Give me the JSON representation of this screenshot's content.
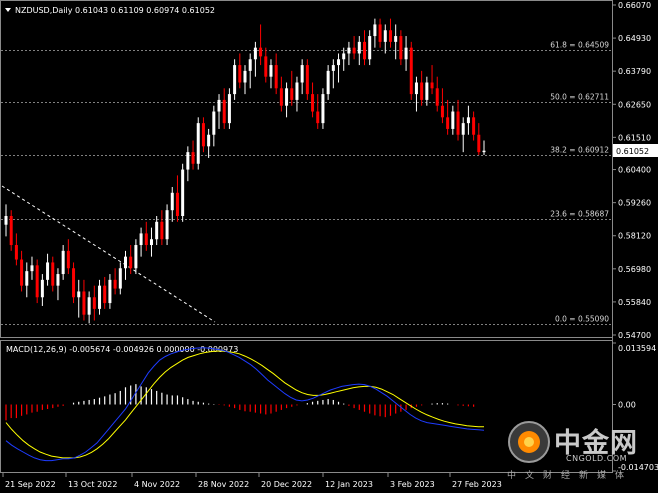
{
  "symbol_line": "NZDUSD,Daily  0.61043 0.61109 0.60974 0.61052",
  "macd_label": "MACD(12,26,9) -0.005674 -0.004926 0.000000 -0.000973",
  "colors": {
    "up": "#ffffff",
    "down": "#ff0000",
    "macd_line": "#1e3cff",
    "signal_line": "#ffff00",
    "hist_down": "#ff0000",
    "hist_up": "#ffffff",
    "trend_line": "#ffffff",
    "fib_line": "#808080"
  },
  "price_axis": [
    "0.66070",
    "0.64930",
    "0.63790",
    "0.62650",
    "0.61510",
    "0.60400",
    "0.59260",
    "0.58120",
    "0.56980",
    "0.55840",
    "0.54700"
  ],
  "current_price": "0.61052",
  "macd_axis": [
    "0.013594",
    "0.00",
    "-0.014703"
  ],
  "time_axis": [
    "21 Sep 2022",
    "13 Oct 2022",
    "4 Nov 2022",
    "28 Nov 2022",
    "20 Dec 2022",
    "12 Jan 2023",
    "3 Feb 2023",
    "27 Feb 2023"
  ],
  "fib_levels": [
    {
      "label": "61.8 = 0.64509",
      "value": 0.64509
    },
    {
      "label": "50.0 = 0.62711",
      "value": 0.62711
    },
    {
      "label": "38.2 = 0.60912",
      "value": 0.60912
    },
    {
      "label": "23.6 = 0.58687",
      "value": 0.58687
    },
    {
      "label": "0.0 = 0.55090",
      "value": 0.5509
    }
  ],
  "watermark": {
    "cn": "中金网",
    "en": "CNGOLD.COM",
    "slogan": "中文财经新媒体"
  },
  "chart_data": {
    "type": "candlestick",
    "title": "NZDUSD,Daily",
    "ylim": [
      0.547,
      0.6607
    ],
    "candles": [
      [
        0.585,
        0.592,
        0.581,
        0.588
      ],
      [
        0.588,
        0.59,
        0.576,
        0.578
      ],
      [
        0.578,
        0.582,
        0.571,
        0.573
      ],
      [
        0.573,
        0.576,
        0.562,
        0.564
      ],
      [
        0.564,
        0.572,
        0.56,
        0.569
      ],
      [
        0.569,
        0.574,
        0.566,
        0.571
      ],
      [
        0.571,
        0.573,
        0.558,
        0.56
      ],
      [
        0.56,
        0.568,
        0.557,
        0.566
      ],
      [
        0.566,
        0.575,
        0.564,
        0.572
      ],
      [
        0.572,
        0.574,
        0.562,
        0.564
      ],
      [
        0.564,
        0.57,
        0.559,
        0.568
      ],
      [
        0.568,
        0.578,
        0.566,
        0.576
      ],
      [
        0.576,
        0.58,
        0.568,
        0.57
      ],
      [
        0.57,
        0.572,
        0.558,
        0.56
      ],
      [
        0.56,
        0.566,
        0.553,
        0.562
      ],
      [
        0.562,
        0.566,
        0.552,
        0.554
      ],
      [
        0.554,
        0.562,
        0.551,
        0.56
      ],
      [
        0.56,
        0.564,
        0.552,
        0.556
      ],
      [
        0.556,
        0.566,
        0.554,
        0.564
      ],
      [
        0.564,
        0.567,
        0.556,
        0.558
      ],
      [
        0.558,
        0.568,
        0.556,
        0.566
      ],
      [
        0.566,
        0.57,
        0.561,
        0.563
      ],
      [
        0.563,
        0.572,
        0.561,
        0.57
      ],
      [
        0.57,
        0.576,
        0.566,
        0.574
      ],
      [
        0.574,
        0.578,
        0.568,
        0.57
      ],
      [
        0.57,
        0.58,
        0.568,
        0.578
      ],
      [
        0.578,
        0.584,
        0.574,
        0.582
      ],
      [
        0.582,
        0.586,
        0.576,
        0.578
      ],
      [
        0.578,
        0.584,
        0.574,
        0.58
      ],
      [
        0.58,
        0.588,
        0.578,
        0.586
      ],
      [
        0.586,
        0.59,
        0.578,
        0.58
      ],
      [
        0.58,
        0.592,
        0.578,
        0.59
      ],
      [
        0.59,
        0.598,
        0.586,
        0.596
      ],
      [
        0.596,
        0.602,
        0.586,
        0.588
      ],
      [
        0.588,
        0.606,
        0.586,
        0.604
      ],
      [
        0.604,
        0.612,
        0.6,
        0.61
      ],
      [
        0.61,
        0.614,
        0.604,
        0.606
      ],
      [
        0.606,
        0.622,
        0.604,
        0.62
      ],
      [
        0.62,
        0.622,
        0.61,
        0.612
      ],
      [
        0.612,
        0.618,
        0.608,
        0.616
      ],
      [
        0.616,
        0.626,
        0.612,
        0.624
      ],
      [
        0.624,
        0.63,
        0.618,
        0.628
      ],
      [
        0.628,
        0.632,
        0.618,
        0.62
      ],
      [
        0.62,
        0.632,
        0.618,
        0.63
      ],
      [
        0.63,
        0.642,
        0.628,
        0.64
      ],
      [
        0.64,
        0.644,
        0.632,
        0.634
      ],
      [
        0.634,
        0.64,
        0.63,
        0.638
      ],
      [
        0.638,
        0.644,
        0.632,
        0.642
      ],
      [
        0.642,
        0.648,
        0.636,
        0.646
      ],
      [
        0.646,
        0.654,
        0.64,
        0.643
      ],
      [
        0.643,
        0.646,
        0.634,
        0.636
      ],
      [
        0.636,
        0.642,
        0.632,
        0.64
      ],
      [
        0.64,
        0.644,
        0.63,
        0.632
      ],
      [
        0.632,
        0.636,
        0.624,
        0.626
      ],
      [
        0.626,
        0.634,
        0.622,
        0.632
      ],
      [
        0.632,
        0.638,
        0.626,
        0.628
      ],
      [
        0.628,
        0.636,
        0.624,
        0.634
      ],
      [
        0.634,
        0.642,
        0.63,
        0.64
      ],
      [
        0.64,
        0.642,
        0.628,
        0.63
      ],
      [
        0.63,
        0.634,
        0.622,
        0.624
      ],
      [
        0.624,
        0.63,
        0.618,
        0.62
      ],
      [
        0.62,
        0.632,
        0.618,
        0.63
      ],
      [
        0.63,
        0.64,
        0.628,
        0.638
      ],
      [
        0.638,
        0.642,
        0.632,
        0.64
      ],
      [
        0.64,
        0.644,
        0.634,
        0.642
      ],
      [
        0.642,
        0.646,
        0.638,
        0.644
      ],
      [
        0.644,
        0.648,
        0.64,
        0.646
      ],
      [
        0.646,
        0.65,
        0.642,
        0.644
      ],
      [
        0.644,
        0.65,
        0.64,
        0.648
      ],
      [
        0.648,
        0.652,
        0.64,
        0.642
      ],
      [
        0.642,
        0.652,
        0.64,
        0.65
      ],
      [
        0.65,
        0.656,
        0.646,
        0.654
      ],
      [
        0.654,
        0.656,
        0.646,
        0.648
      ],
      [
        0.648,
        0.654,
        0.644,
        0.652
      ],
      [
        0.652,
        0.656,
        0.646,
        0.648
      ],
      [
        0.648,
        0.654,
        0.642,
        0.65
      ],
      [
        0.65,
        0.652,
        0.64,
        0.642
      ],
      [
        0.642,
        0.65,
        0.638,
        0.646
      ],
      [
        0.646,
        0.648,
        0.628,
        0.63
      ],
      [
        0.63,
        0.636,
        0.624,
        0.634
      ],
      [
        0.634,
        0.638,
        0.626,
        0.628
      ],
      [
        0.628,
        0.636,
        0.626,
        0.634
      ],
      [
        0.634,
        0.64,
        0.63,
        0.632
      ],
      [
        0.632,
        0.636,
        0.624,
        0.626
      ],
      [
        0.626,
        0.632,
        0.62,
        0.622
      ],
      [
        0.622,
        0.628,
        0.616,
        0.618
      ],
      [
        0.618,
        0.626,
        0.616,
        0.624
      ],
      [
        0.624,
        0.628,
        0.614,
        0.616
      ],
      [
        0.616,
        0.622,
        0.61,
        0.62
      ],
      [
        0.62,
        0.626,
        0.616,
        0.622
      ],
      [
        0.622,
        0.624,
        0.614,
        0.616
      ],
      [
        0.616,
        0.62,
        0.609,
        0.61
      ],
      [
        0.61,
        0.614,
        0.609,
        0.6105
      ]
    ],
    "macd_hist": [
      -0.0035,
      -0.003,
      -0.003,
      -0.0025,
      -0.0022,
      -0.0018,
      -0.0016,
      -0.0012,
      -0.001,
      -0.0008,
      -0.0005,
      -0.0003,
      0.0,
      0.0004,
      0.0006,
      0.0008,
      0.001,
      0.0012,
      0.0015,
      0.0018,
      0.0022,
      0.0025,
      0.003,
      0.0038,
      0.0042,
      0.0045,
      0.004,
      0.0038,
      0.0034,
      0.003,
      0.0026,
      0.0022,
      0.002,
      0.002,
      0.0016,
      0.0012,
      0.0008,
      0.0006,
      0.0004,
      0.0002,
      0.0001,
      -0.0001,
      -0.0002,
      -0.0005,
      -0.0008,
      -0.0012,
      -0.0015,
      -0.0016,
      -0.0018,
      -0.002,
      -0.0022,
      -0.002,
      -0.0016,
      -0.0012,
      -0.0008,
      -0.0005,
      -0.0002,
      0.0,
      0.0003,
      0.0006,
      0.0008,
      0.001,
      0.0012,
      0.001,
      0.0006,
      0.0002,
      -0.0003,
      -0.0008,
      -0.0012,
      -0.0016,
      -0.002,
      -0.0024,
      -0.0026,
      -0.0028,
      -0.0025,
      -0.002,
      -0.0016,
      -0.0012,
      -0.0008,
      -0.0005,
      -0.0002,
      0.0,
      0.0002,
      0.0003,
      0.0003,
      0.0002,
      0.0,
      -0.0002,
      -0.0003,
      -0.0004,
      -0.0005
    ],
    "macd_line": [
      -0.008,
      -0.009,
      -0.0098,
      -0.0105,
      -0.0112,
      -0.0118,
      -0.0122,
      -0.0124,
      -0.0124,
      -0.0122,
      -0.012,
      -0.012,
      -0.0118,
      -0.0112,
      -0.0105,
      -0.0095,
      -0.0085,
      -0.007,
      -0.0055,
      -0.004,
      -0.0025,
      -0.001,
      0.001,
      0.003,
      0.005,
      0.007,
      0.0085,
      0.0098,
      0.0106,
      0.0112,
      0.0116,
      0.012,
      0.0122,
      0.0124,
      0.0125,
      0.0125,
      0.0124,
      0.0122,
      0.012,
      0.0116,
      0.011,
      0.0104,
      0.0096,
      0.0088,
      0.0078,
      0.0066,
      0.0054,
      0.0044,
      0.0034,
      0.0024,
      0.0016,
      0.001,
      0.0008,
      0.001,
      0.0014,
      0.002,
      0.0026,
      0.0032,
      0.0036,
      0.004,
      0.0042,
      0.0044,
      0.0045,
      0.0044,
      0.004,
      0.0034,
      0.0026,
      0.0018,
      0.0008,
      -0.0002,
      -0.0012,
      -0.0022,
      -0.003,
      -0.0036,
      -0.004,
      -0.0042,
      -0.0044,
      -0.0046,
      -0.0048,
      -0.005,
      -0.0052,
      -0.0054,
      -0.0055,
      -0.0056,
      -0.0057
    ],
    "signal_line": [
      -0.004,
      -0.0055,
      -0.0068,
      -0.008,
      -0.009,
      -0.0098,
      -0.0105,
      -0.011,
      -0.0114,
      -0.0116,
      -0.0118,
      -0.0118,
      -0.0118,
      -0.0116,
      -0.0112,
      -0.0106,
      -0.0098,
      -0.0088,
      -0.0076,
      -0.0062,
      -0.0048,
      -0.0034,
      -0.0018,
      -0.0002,
      0.0014,
      0.003,
      0.0046,
      0.006,
      0.0072,
      0.0082,
      0.009,
      0.0098,
      0.0104,
      0.0108,
      0.0112,
      0.0115,
      0.0117,
      0.0118,
      0.0118,
      0.0117,
      0.0115,
      0.0112,
      0.0107,
      0.0101,
      0.0094,
      0.0086,
      0.0077,
      0.0068,
      0.0058,
      0.0048,
      0.004,
      0.0032,
      0.0026,
      0.0022,
      0.002,
      0.002,
      0.0022,
      0.0025,
      0.0028,
      0.0031,
      0.0034,
      0.0037,
      0.0039,
      0.004,
      0.004,
      0.0038,
      0.0034,
      0.0028,
      0.0022,
      0.0014,
      0.0006,
      -0.0002,
      -0.001,
      -0.0017,
      -0.0023,
      -0.0028,
      -0.0033,
      -0.0037,
      -0.004,
      -0.0043,
      -0.0045,
      -0.0047,
      -0.0048,
      -0.0049,
      -0.0049
    ]
  }
}
